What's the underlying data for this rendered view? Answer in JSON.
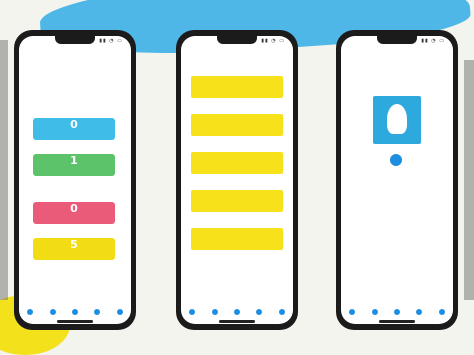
{
  "phones": [
    {
      "status": {
        "time": "",
        "icons": "▮▮ ◔ ▭"
      },
      "cards": [
        {
          "value": "0",
          "label": "",
          "color": "#40bce8"
        },
        {
          "value": "1",
          "label": "",
          "color": "#5cc36b"
        },
        {
          "value": "0",
          "label": "",
          "color": "#ea5a79"
        },
        {
          "value": "5",
          "label": "",
          "color": "#f2dd14"
        }
      ],
      "tabs": [
        "home-icon",
        "chart-icon",
        "user-icon",
        "gear-icon",
        "info-icon"
      ]
    },
    {
      "status": {
        "time": "",
        "icons": "▮▮ ◔ ▭"
      },
      "rows": [
        {
          "title": "",
          "subtitle": ""
        },
        {
          "title": "",
          "subtitle": ""
        },
        {
          "title": "",
          "subtitle": ""
        },
        {
          "title": "",
          "subtitle": ""
        },
        {
          "title": "",
          "subtitle": ""
        }
      ],
      "tabs": [
        "home-icon",
        "chart-icon",
        "user-icon",
        "gear-icon",
        "info-icon"
      ]
    },
    {
      "status": {
        "time": "",
        "icons": "▮▮ ◔ ▭"
      },
      "profile": {
        "title": "",
        "badge": "",
        "name": "",
        "subtitle": "",
        "small": "",
        "lines": [
          "",
          "",
          ""
        ]
      },
      "tabs": [
        "home-icon",
        "chart-icon",
        "user-icon",
        "gear-icon",
        "info-icon"
      ]
    }
  ],
  "colors": {
    "accent": "#1e8fe0",
    "yellow": "#f6e11a"
  }
}
